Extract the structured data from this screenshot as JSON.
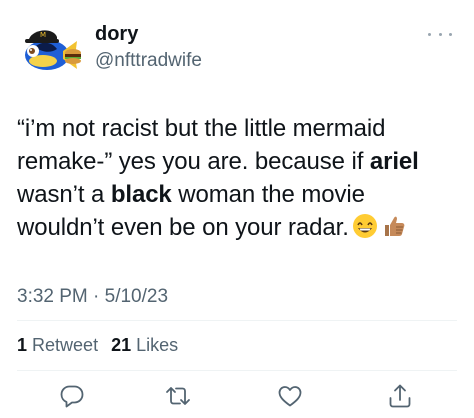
{
  "user": {
    "display_name": "dory",
    "handle": "@nfttradwife",
    "avatar": "dory-fish-avatar-icon"
  },
  "tweet": {
    "lines": [
      [
        "“i’m not racist but the little mermaid"
      ],
      [
        "remake-” yes you are. because if ",
        "ariel"
      ],
      [
        "wasn’t a ",
        "black",
        " woman the movie"
      ],
      [
        "wouldn’t even be on your radar."
      ]
    ],
    "line1": "“i’m not racist but the little mermaid",
    "line2_a": "remake-” yes you are. because if ",
    "line2_b": "ariel",
    "line3_a": "wasn’t a ",
    "line3_b": "black",
    "line3_c": " woman the movie",
    "line4": "wouldn’t even be on your radar.",
    "emojis": [
      "grinning-face-emoji",
      "thumbs-up-emoji"
    ]
  },
  "timestamp": "3:32 PM · 5/10/23",
  "stats": {
    "retweets_count": "1",
    "retweets_label": "Retweet",
    "likes_count": "21",
    "likes_label": "Likes"
  },
  "icons": {
    "reply": "reply-icon",
    "retweet": "retweet-icon",
    "like": "like-icon",
    "share": "share-icon",
    "more": "more-icon"
  },
  "colors": {
    "text": "#0f1419",
    "secondary": "#536471",
    "divider": "#eff3f4"
  }
}
